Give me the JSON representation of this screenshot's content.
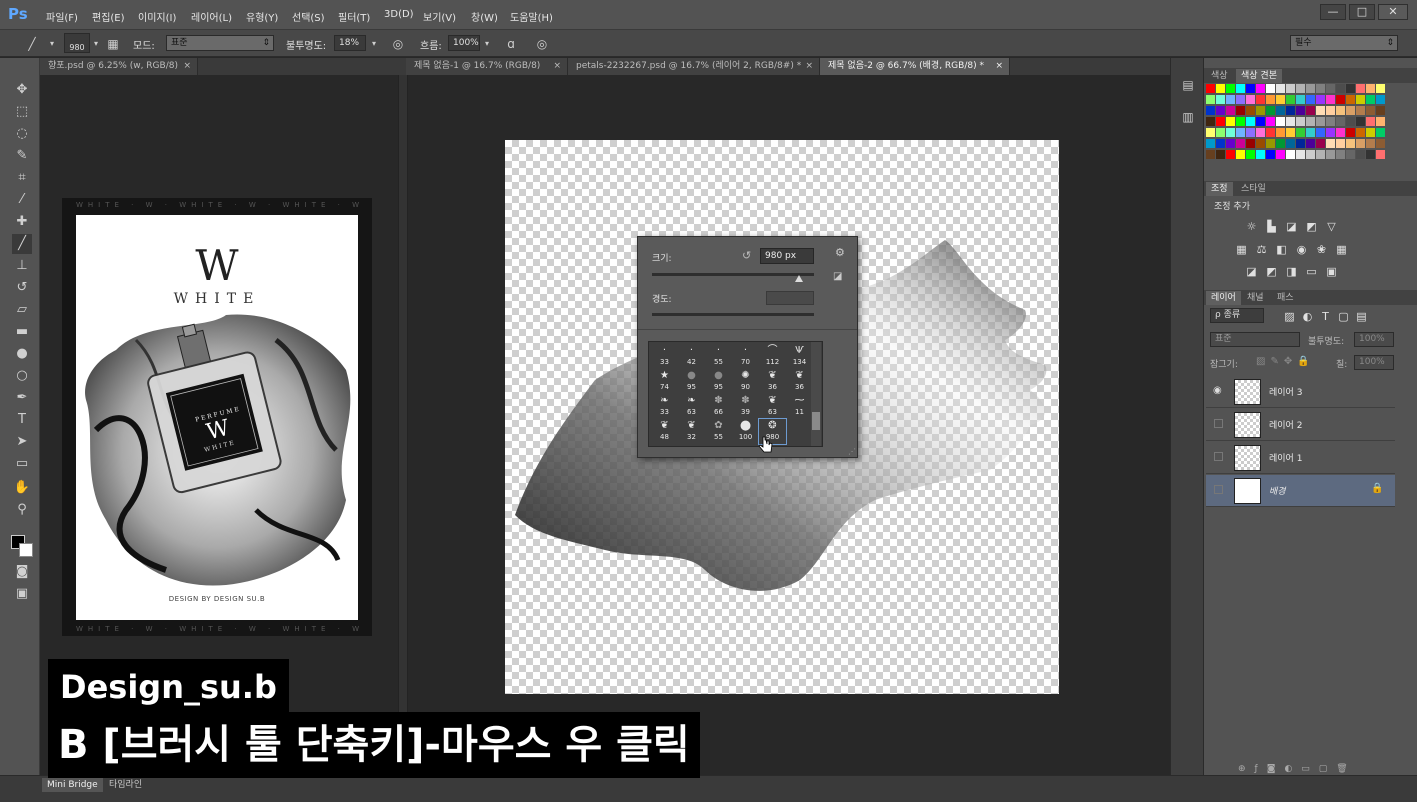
{
  "app": {
    "logo": "Ps"
  },
  "menu": [
    "파일(F)",
    "편집(E)",
    "이미지(I)",
    "레이어(L)",
    "유형(Y)",
    "선택(S)",
    "필터(T)",
    "3D(D)",
    "보기(V)",
    "창(W)",
    "도움말(H)"
  ],
  "window_controls": {
    "minimize": "—",
    "maximize": "□",
    "close": "✕"
  },
  "options": {
    "brush_size": "980",
    "mode_label": "모드:",
    "mode_value": "표준",
    "opacity_label": "불투명도:",
    "opacity_value": "18%",
    "flow_label": "흐름:",
    "flow_value": "100%",
    "workspace": "필수"
  },
  "tabs": [
    {
      "label": "향포.psd @ 6.25% (w, RGB/8)",
      "close": "×"
    },
    {
      "label": "제목 없음-1 @ 16.7% (RGB/8)",
      "close": "×"
    },
    {
      "label": "petals-2232267.psd @ 16.7% (레이어 2, RGB/8#) *",
      "close": "×"
    },
    {
      "label": "제목 없음-2 @ 66.7% (배경, RGB/8) *",
      "close": "×"
    }
  ],
  "poster": {
    "monogram": "W",
    "brand": "WHITE",
    "bottle_text": "PERFUME",
    "bottle_monogram": "W",
    "bottle_brand": "WHITE",
    "credit": "DESIGN BY DESIGN SU.B",
    "frame_text": "WHITE · W · WHITE · W · WHITE · W"
  },
  "brush_popup": {
    "size_label": "크기:",
    "size_value": "980 px",
    "hardness_label": "경도:",
    "rows": [
      [
        "33",
        "42",
        "55",
        "70",
        "112",
        "134"
      ],
      [
        "74",
        "95",
        "95",
        "90",
        "36",
        "36"
      ],
      [
        "33",
        "63",
        "66",
        "39",
        "63",
        "11"
      ],
      [
        "48",
        "32",
        "55",
        "100",
        "980",
        ""
      ]
    ]
  },
  "right_panel": {
    "color_tabs": [
      "색상",
      "색상 견본"
    ],
    "adjust_tabs": [
      "조정",
      "스타일"
    ],
    "adjust_title": "조정 추가",
    "layer_tabs": [
      "레이어",
      "채널",
      "패스"
    ],
    "filter_label": "ρ 종류",
    "blend_mode": "표준",
    "opacity_label": "불투명도:",
    "opacity_value": "100%",
    "lock_label": "잠그기:",
    "fill_label": "칠:",
    "fill_value": "100%",
    "layers": [
      {
        "name": "레이어 3",
        "visible": true
      },
      {
        "name": "레이어 2",
        "visible": false
      },
      {
        "name": "레이어 1",
        "visible": false
      },
      {
        "name": "배경",
        "visible": false,
        "locked": true
      }
    ]
  },
  "swatch_colors": [
    "#ff0000",
    "#ffff00",
    "#00ff00",
    "#00ffff",
    "#0000ff",
    "#ff00ff",
    "#ffffff",
    "#e6e6e6",
    "#cccccc",
    "#b3b3b3",
    "#999999",
    "#808080",
    "#666666",
    "#4d4d4d",
    "#333333",
    "#ff6f6f",
    "#ffb36f",
    "#ffff6f",
    "#8cff6f",
    "#6fffd9",
    "#6fb3ff",
    "#8c6fff",
    "#ff6fd9",
    "#ff3333",
    "#ff9933",
    "#ffcc33",
    "#33cc33",
    "#33cccc",
    "#3366ff",
    "#9933ff",
    "#ff33cc",
    "#cc0000",
    "#cc6600",
    "#cccc00",
    "#00cc66",
    "#0099cc",
    "#0033cc",
    "#6600cc",
    "#cc0099",
    "#990000",
    "#994c00",
    "#999900",
    "#009933",
    "#006699",
    "#002699",
    "#4c0099",
    "#99004c",
    "#ffdcb4",
    "#ffcfa0",
    "#f5c27d",
    "#d9a066",
    "#b37d4d",
    "#8c5c33",
    "#663f1f",
    "#402510"
  ],
  "bottom": {
    "tabs": [
      "Mini Bridge",
      "타임라인"
    ]
  },
  "captions": {
    "line1": "Design_su.b",
    "line2": "B [브러시 툴 단축키]-마우스 우 클릭"
  }
}
